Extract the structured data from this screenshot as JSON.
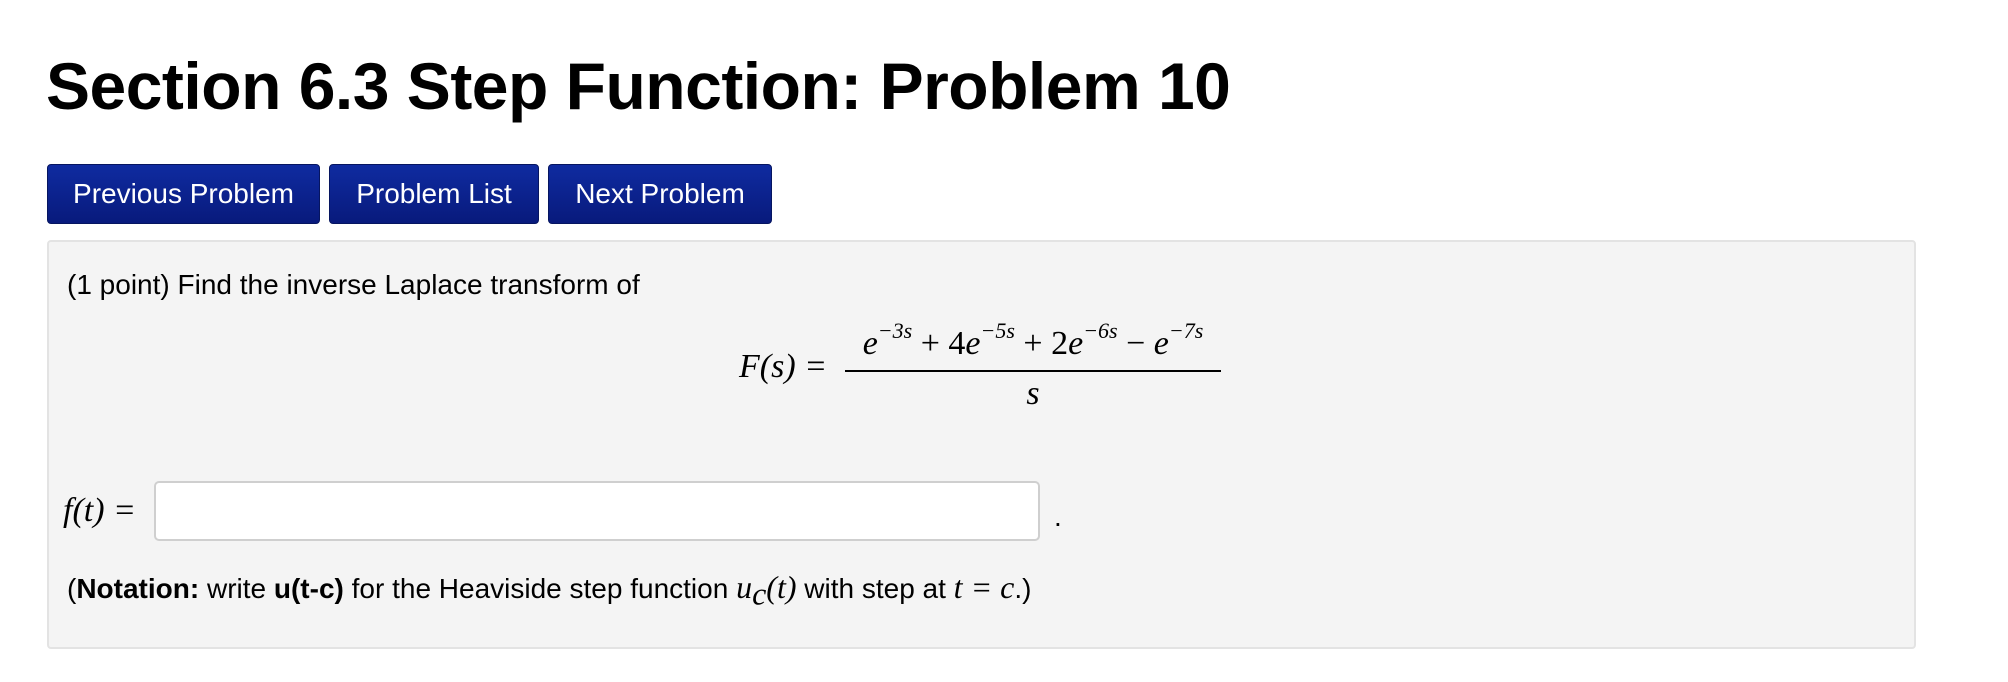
{
  "page": {
    "title": "Section 6.3 Step Function: Problem 10"
  },
  "nav": {
    "previous_label": "Previous Problem",
    "list_label": "Problem List",
    "next_label": "Next Problem"
  },
  "problem": {
    "intro": "(1 point) Find the inverse Laplace transform of",
    "formula": {
      "lhs": "F(s) =",
      "numerator": {
        "t1_base": "e",
        "t1_exp": "−3s",
        "op1": " + ",
        "t2_coef": "4",
        "t2_base": "e",
        "t2_exp": "−5s",
        "op2": " + ",
        "t3_coef": "2",
        "t3_base": "e",
        "t3_exp": "−6s",
        "op3": " − ",
        "t4_base": "e",
        "t4_exp": "−7s"
      },
      "denominator": "s"
    },
    "answer": {
      "label": "f(t) =",
      "value": "",
      "placeholder": "",
      "trailing": "."
    },
    "notation": {
      "open": "(",
      "label": "Notation:",
      "text1": " write ",
      "code": "u(t-c)",
      "text2": " for the Heaviside step function ",
      "func": "u",
      "func_sub": "c",
      "func_arg": "(t)",
      "text3": " with step at ",
      "eq": "t = c",
      "close": ".)"
    }
  },
  "colors": {
    "button_bg": "#0c2290",
    "button_text": "#ffffff",
    "box_bg": "#f4f4f4",
    "box_border": "#e3e3e3"
  }
}
